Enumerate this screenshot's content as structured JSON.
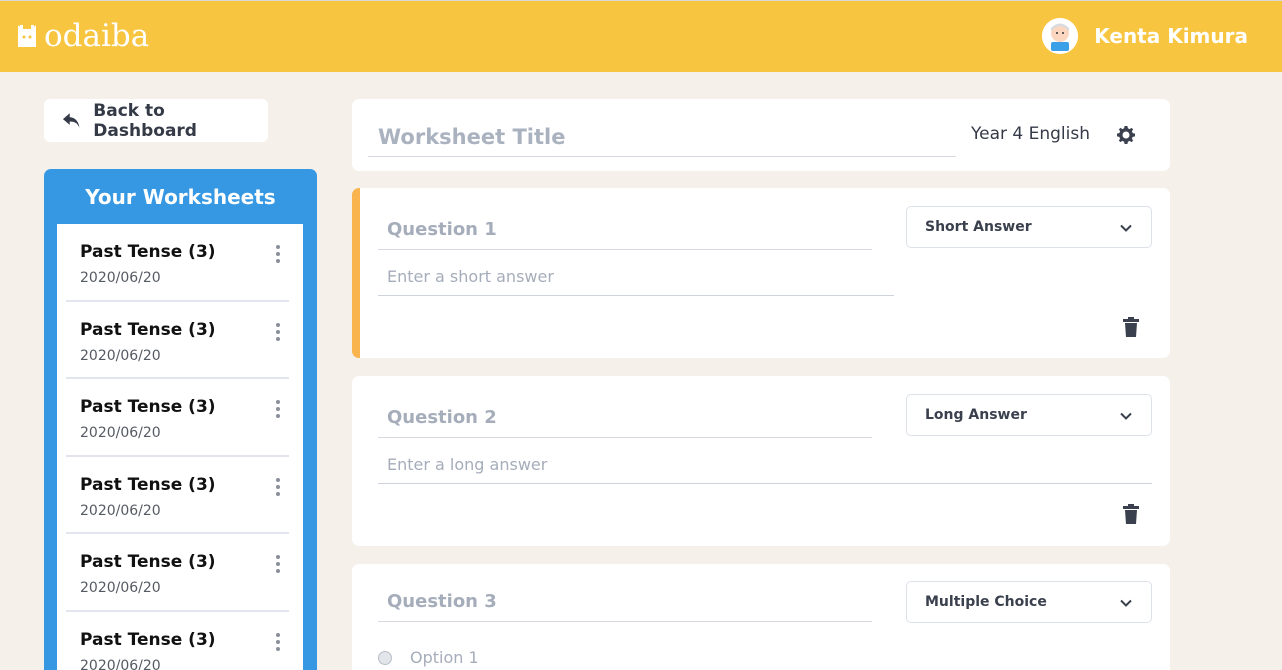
{
  "app": {
    "logo_text": "odaiba",
    "user_name": "Kenta Kimura"
  },
  "nav": {
    "back_label": "Back to Dashboard"
  },
  "sidebar": {
    "title": "Your Worksheets",
    "items": [
      {
        "name": "Past Tense (3)",
        "date": "2020/06/20"
      },
      {
        "name": "Past Tense (3)",
        "date": "2020/06/20"
      },
      {
        "name": "Past Tense (3)",
        "date": "2020/06/20"
      },
      {
        "name": "Past Tense (3)",
        "date": "2020/06/20"
      },
      {
        "name": "Past Tense (3)",
        "date": "2020/06/20"
      },
      {
        "name": "Past Tense (3)",
        "date": "2020/06/20"
      }
    ]
  },
  "worksheet": {
    "title_placeholder": "Worksheet Title",
    "subject": "Year 4 English"
  },
  "questions": [
    {
      "placeholder": "Question 1",
      "type": "Short Answer",
      "answer_placeholder": "Enter a short answer"
    },
    {
      "placeholder": "Question 2",
      "type": "Long Answer",
      "answer_placeholder": "Enter a long answer"
    },
    {
      "placeholder": "Question 3",
      "type": "Multiple Choice",
      "options": [
        "Option 1"
      ]
    }
  ],
  "colors": {
    "header": "#f7c540",
    "sidebar": "#3698e3",
    "active_accent": "#f9b44f",
    "background": "#f5f1ea"
  }
}
